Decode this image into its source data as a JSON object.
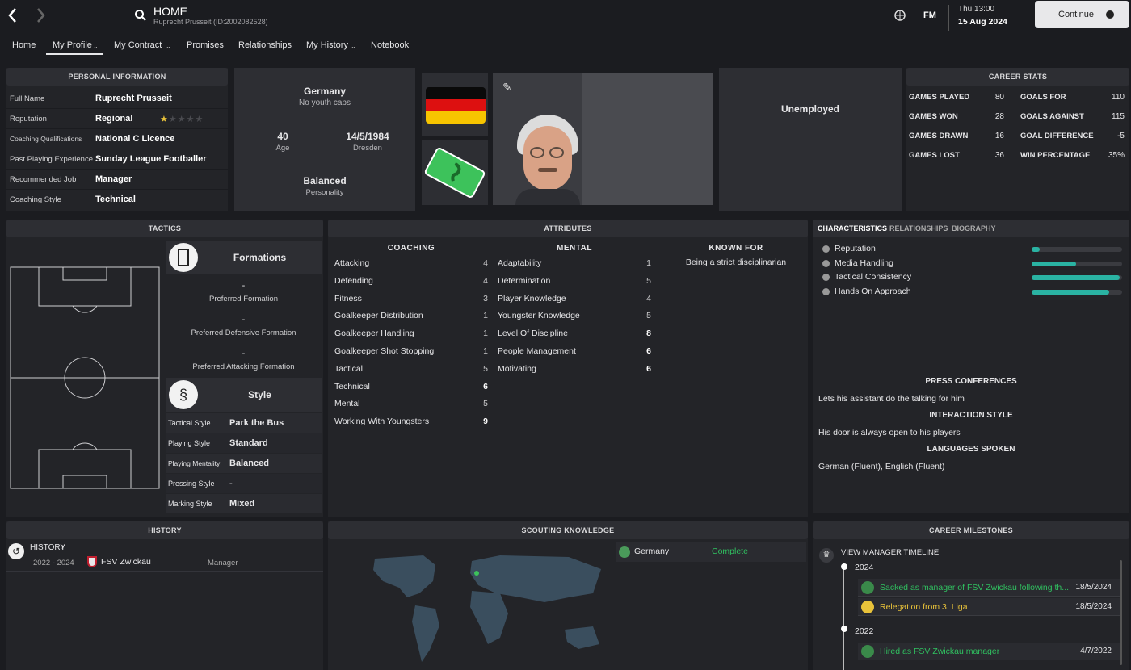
{
  "header": {
    "title": "HOME",
    "subtitle": "Ruprecht Prusseit (ID:2002082528)",
    "day": "Thu 13:00",
    "date": "15 Aug 2024",
    "continue_label": "Continue",
    "fm_label": "FM"
  },
  "nav": {
    "items": [
      "Home",
      "My Profile",
      "My Contract",
      "Promises",
      "Relationships",
      "My History",
      "Notebook"
    ]
  },
  "personal": {
    "title": "PERSONAL INFORMATION",
    "rows": [
      {
        "label": "Full Name",
        "value": "Ruprecht Prusseit"
      },
      {
        "label": "Reputation",
        "value": "Regional"
      },
      {
        "label": "Coaching Qualifications",
        "value": "National C Licence"
      },
      {
        "label": "Past Playing Experience",
        "value": "Sunday League Footballer"
      },
      {
        "label": "Recommended Job",
        "value": "Manager"
      },
      {
        "label": "Coaching Style",
        "value": "Technical"
      }
    ],
    "reputation_stars": 0.5
  },
  "bio": {
    "nation": "Germany",
    "caps": "No youth caps",
    "age": "40",
    "age_label": "Age",
    "dob": "14/5/1984",
    "birthplace": "Dresden",
    "personality": "Balanced",
    "personality_label": "Personality"
  },
  "club": {
    "status": "Unemployed"
  },
  "career": {
    "title": "CAREER STATS",
    "left": [
      {
        "label": "GAMES PLAYED",
        "value": "80"
      },
      {
        "label": "GAMES WON",
        "value": "28"
      },
      {
        "label": "GAMES DRAWN",
        "value": "16"
      },
      {
        "label": "GAMES LOST",
        "value": "36"
      }
    ],
    "right": [
      {
        "label": "GOALS FOR",
        "value": "110"
      },
      {
        "label": "GOALS AGAINST",
        "value": "115"
      },
      {
        "label": "GOAL DIFFERENCE",
        "value": "-5"
      },
      {
        "label": "WIN PERCENTAGE",
        "value": "35%"
      }
    ]
  },
  "tactics": {
    "title": "TACTICS",
    "formations_label": "Formations",
    "formations": [
      {
        "value": "-",
        "label": "Preferred Formation"
      },
      {
        "value": "-",
        "label": "Preferred Defensive Formation"
      },
      {
        "value": "-",
        "label": "Preferred Attacking Formation"
      }
    ],
    "style_label": "Style",
    "style_rows": [
      {
        "label": "Tactical Style",
        "value": "Park the Bus"
      },
      {
        "label": "Playing Style",
        "value": "Standard"
      },
      {
        "label": "Playing Mentality",
        "value": "Balanced"
      },
      {
        "label": "Pressing Style",
        "value": "-"
      },
      {
        "label": "Marking Style",
        "value": "Mixed"
      }
    ]
  },
  "attributes": {
    "title": "ATTRIBUTES",
    "coaching_title": "COACHING",
    "mental_title": "MENTAL",
    "known_title": "KNOWN FOR",
    "known_text": "Being a strict disciplinarian",
    "coaching": [
      {
        "name": "Attacking",
        "value": "4"
      },
      {
        "name": "Defending",
        "value": "4"
      },
      {
        "name": "Fitness",
        "value": "3"
      },
      {
        "name": "Goalkeeper Distribution",
        "value": "1"
      },
      {
        "name": "Goalkeeper Handling",
        "value": "1"
      },
      {
        "name": "Goalkeeper Shot Stopping",
        "value": "1"
      },
      {
        "name": "Tactical",
        "value": "5"
      },
      {
        "name": "Technical",
        "value": "6"
      },
      {
        "name": "Mental",
        "value": "5"
      },
      {
        "name": "Working With Youngsters",
        "value": "9"
      }
    ],
    "mental": [
      {
        "name": "Adaptability",
        "value": "1"
      },
      {
        "name": "Determination",
        "value": "5"
      },
      {
        "name": "Player Knowledge",
        "value": "4"
      },
      {
        "name": "Youngster Knowledge",
        "value": "5"
      },
      {
        "name": "Level Of Discipline",
        "value": "8"
      },
      {
        "name": "People Management",
        "value": "6"
      },
      {
        "name": "Motivating",
        "value": "6"
      }
    ]
  },
  "characteristics": {
    "tabs": [
      "CHARACTERISTICS",
      "RELATIONSHIPS",
      "BIOGRAPHY"
    ],
    "bars": [
      {
        "label": "Reputation",
        "level": 0.09
      },
      {
        "label": "Media Handling",
        "level": 0.49
      },
      {
        "label": "Tactical Consistency",
        "level": 0.97
      },
      {
        "label": "Hands On Approach",
        "level": 0.86
      }
    ],
    "press_title": "PRESS CONFERENCES",
    "press_text": "Lets his assistant do the talking for him",
    "interaction_title": "INTERACTION STYLE",
    "interaction_text": "His door is always open to his players",
    "languages_title": "LANGUAGES SPOKEN",
    "languages_text": "German (Fluent), English (Fluent)"
  },
  "history": {
    "title": "HISTORY",
    "link": "HISTORY",
    "rows": [
      {
        "years": "2022 - 2024",
        "club": "FSV Zwickau",
        "role": "Manager"
      }
    ]
  },
  "scouting": {
    "title": "SCOUTING KNOWLEDGE",
    "country": "Germany",
    "status": "Complete"
  },
  "milestones": {
    "title": "CAREER MILESTONES",
    "link": "VIEW MANAGER TIMELINE",
    "groups": [
      {
        "year": "2024",
        "items": [
          {
            "text": "Sacked as manager of FSV Zwickau following th...",
            "date": "18/5/2024"
          },
          {
            "text": "Relegation from 3. Liga",
            "date": "18/5/2024"
          }
        ]
      },
      {
        "year": "2022",
        "items": [
          {
            "text": "Hired as FSV Zwickau manager",
            "date": "4/7/2022"
          }
        ]
      }
    ]
  },
  "colors": {
    "accent": "#2ab3a3",
    "green_text": "#30c060",
    "yellow_text": "#e8c23a",
    "bg": "#1b1c20",
    "panel": "#26272c"
  }
}
